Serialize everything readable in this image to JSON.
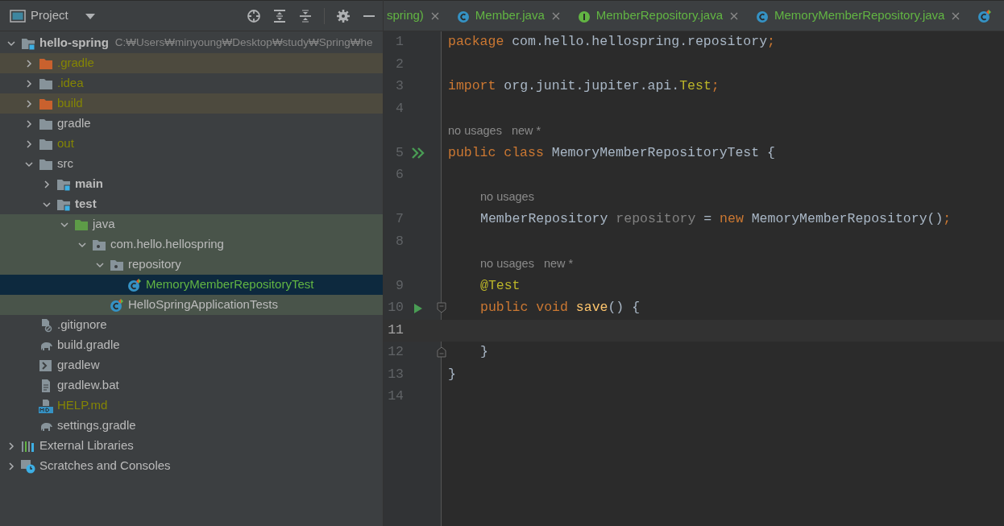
{
  "project_panel": {
    "title": "Project"
  },
  "tree": [
    {
      "label": "hello-spring",
      "path": "C:₩Users₩minyoung₩Desktop₩study₩Spring₩he",
      "kind": "module",
      "bold": true,
      "expanded": true,
      "selected": false,
      "children": [
        {
          "label": ".gradle",
          "kind": "excluded-folder",
          "expanded": false,
          "ignored": true,
          "excluded": true,
          "selected": false
        },
        {
          "label": ".idea",
          "kind": "folder",
          "expanded": false,
          "ignored": true,
          "selected": false
        },
        {
          "label": "build",
          "kind": "excluded-folder",
          "expanded": false,
          "ignored": true,
          "excluded": true,
          "selected": false
        },
        {
          "label": "gradle",
          "kind": "folder",
          "expanded": false,
          "selected": false
        },
        {
          "label": "out",
          "kind": "folder",
          "expanded": false,
          "ignored": true,
          "selected": false
        },
        {
          "label": "src",
          "kind": "folder",
          "expanded": true,
          "selected": false,
          "children": [
            {
              "label": "main",
              "kind": "module",
              "bold": true,
              "expanded": false,
              "selected": false
            },
            {
              "label": "test",
              "kind": "module",
              "bold": true,
              "expanded": true,
              "selected": false,
              "children": [
                {
                  "label": "java",
                  "kind": "test-folder",
                  "expanded": true,
                  "test_source": true,
                  "selected": false,
                  "children": [
                    {
                      "label": "com.hello.hellospring",
                      "kind": "package",
                      "expanded": true,
                      "test_source": true,
                      "selected": false,
                      "children": [
                        {
                          "label": "repository",
                          "kind": "package",
                          "expanded": true,
                          "test_source": true,
                          "selected": false,
                          "children": [
                            {
                              "label": "MemoryMemberRepositoryTest",
                              "kind": "test-class",
                              "added": true,
                              "selected": true
                            }
                          ]
                        },
                        {
                          "label": "HelloSpringApplicationTests",
                          "kind": "test-class",
                          "test_source": true,
                          "selected": false
                        }
                      ]
                    }
                  ]
                }
              ]
            }
          ]
        },
        {
          "label": ".gitignore",
          "kind": "ignore-file",
          "selected": false
        },
        {
          "label": "build.gradle",
          "kind": "gradle",
          "selected": false
        },
        {
          "label": "gradlew",
          "kind": "script",
          "selected": false
        },
        {
          "label": "gradlew.bat",
          "kind": "text-file",
          "selected": false
        },
        {
          "label": "HELP.md",
          "kind": "markdown",
          "ignored": true,
          "selected": false
        },
        {
          "label": "settings.gradle",
          "kind": "gradle",
          "selected": false
        }
      ]
    },
    {
      "label": "External Libraries",
      "kind": "libraries",
      "expanded": false,
      "selected": false
    },
    {
      "label": "Scratches and Consoles",
      "kind": "scratches",
      "expanded": false,
      "selected": false
    }
  ],
  "tabs": [
    {
      "label": "spring)",
      "kind": "plain",
      "added": true
    },
    {
      "label": "Member.java",
      "kind": "class",
      "added": true
    },
    {
      "label": "MemberRepository.java",
      "kind": "interface",
      "added": true
    },
    {
      "label": "MemoryMemberRepository.java",
      "kind": "class",
      "added": true
    },
    {
      "kind": "test-class"
    }
  ],
  "editor_lines": [
    {
      "kind": "code",
      "number": "1",
      "indented": false,
      "tokens": [
        {
          "text": "package",
          "kind": "keyword"
        },
        {
          "text": " com.hello.hellospring.repository",
          "kind": "plain"
        },
        {
          "text": ";",
          "kind": "keyword"
        }
      ]
    },
    {
      "kind": "code",
      "number": "2"
    },
    {
      "kind": "code",
      "number": "3",
      "indented": false,
      "tokens": [
        {
          "text": "import",
          "kind": "keyword"
        },
        {
          "text": " org.junit.jupiter.api.",
          "kind": "plain"
        },
        {
          "text": "Test",
          "kind": "annotation"
        },
        {
          "text": ";",
          "kind": "keyword"
        }
      ]
    },
    {
      "kind": "code",
      "number": "4"
    },
    {
      "kind": "hint",
      "indented": false,
      "hints": [
        "no usages",
        "new *"
      ]
    },
    {
      "kind": "code",
      "number": "5",
      "indented": false,
      "gutter_icon": {
        "kind": "run-all"
      },
      "tokens": [
        {
          "text": "public class",
          "kind": "keyword"
        },
        {
          "text": " MemoryMemberRepositoryTest {",
          "kind": "plain"
        }
      ]
    },
    {
      "kind": "code",
      "number": "6"
    },
    {
      "kind": "hint",
      "indented": true,
      "hints": [
        "no usages"
      ]
    },
    {
      "kind": "code",
      "number": "7",
      "indented": true,
      "tokens": [
        {
          "text": "MemberRepository ",
          "kind": "plain"
        },
        {
          "text": "repository",
          "kind": "unused"
        },
        {
          "text": " = ",
          "kind": "plain"
        },
        {
          "text": "new",
          "kind": "keyword"
        },
        {
          "text": " MemoryMemberRepository()",
          "kind": "plain"
        },
        {
          "text": ";",
          "kind": "keyword"
        }
      ]
    },
    {
      "kind": "code",
      "number": "8"
    },
    {
      "kind": "hint",
      "indented": true,
      "hints": [
        "no usages",
        "new *"
      ]
    },
    {
      "kind": "code",
      "number": "9",
      "indented": true,
      "tokens": [
        {
          "text": "@Test",
          "kind": "annotation"
        }
      ]
    },
    {
      "kind": "code",
      "number": "10",
      "indented": true,
      "gutter_icon": {
        "kind": "run"
      },
      "fold": {
        "kind": "start"
      },
      "tokens": [
        {
          "text": "public void ",
          "kind": "keyword"
        },
        {
          "text": "save",
          "kind": "method"
        },
        {
          "text": "() {",
          "kind": "plain"
        }
      ]
    },
    {
      "kind": "code",
      "number": "11",
      "current": true
    },
    {
      "kind": "code",
      "number": "12",
      "indented": true,
      "fold": {
        "kind": "end"
      },
      "tokens": [
        {
          "text": "}",
          "kind": "plain"
        }
      ]
    },
    {
      "kind": "code",
      "number": "13",
      "indented": false,
      "tokens": [
        {
          "text": "}",
          "kind": "plain"
        }
      ]
    },
    {
      "kind": "code",
      "number": "14"
    }
  ]
}
